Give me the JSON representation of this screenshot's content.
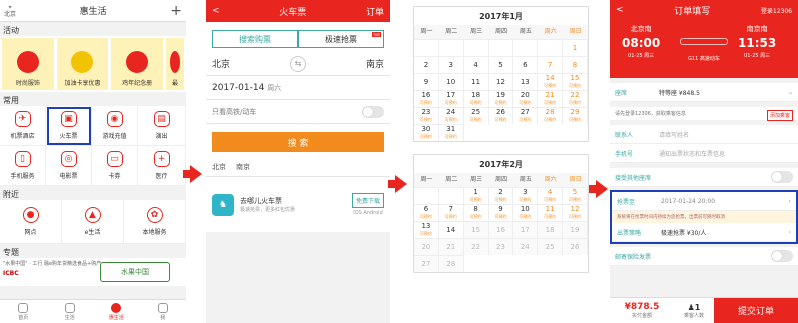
{
  "panel1": {
    "location": "北京",
    "title": "惠生活",
    "plus": "+",
    "activities_label": "活动",
    "activities": [
      "时尚服饰",
      "加油卡享优惠",
      "鸡年纪念册",
      "最"
    ],
    "activity_colors": [
      "#e8261f",
      "#f2c300",
      "#e8261f",
      "#e8261f"
    ],
    "common_label": "常用",
    "common_items": [
      "机票酒店",
      "火车票",
      "游戏充值",
      "演出",
      "手机服务",
      "电影票",
      "卡券",
      "医疗"
    ],
    "nearby_label": "附近",
    "nearby_items": [
      "网点",
      "e生活",
      "本地服务"
    ],
    "topic_label": "专题",
    "promo_text": "\"水果中国\" · 工行 融e购年货精选食品+购产",
    "promo_logo1": "ICBC",
    "promo_logo2": "水果中国",
    "tabs": [
      "首页",
      "生活",
      "惠生活",
      "我"
    ]
  },
  "panel2": {
    "title": "火车票",
    "back": "<",
    "right": "订单",
    "seg_on": "搜索购票",
    "seg_off": "极速抢票",
    "hot": "hot",
    "from": "北京",
    "to": "南京",
    "swap": "⇆",
    "date": "2017-01-14",
    "weekday": "周六",
    "high_speed_only": "只看高铁/动车",
    "search": "搜 索",
    "history_from": "北京",
    "history_to": "南京",
    "banner_title": "去哪儿火车票",
    "banner_sub": "极速抢票，更多红包优惠",
    "download": "免费下载",
    "os": "IOS Android"
  },
  "panel3": {
    "week": [
      "周一",
      "周二",
      "周三",
      "周四",
      "周五",
      "周六",
      "周日"
    ],
    "jan_title": "2017年1月",
    "feb_title": "2017年2月",
    "bookable": "可预约",
    "jan_days": [
      "",
      "",
      "",
      "",
      "",
      "",
      "1",
      "2",
      "3",
      "4",
      "5",
      "6",
      "7",
      "8",
      "9",
      "10",
      "11",
      "12",
      "13",
      "14",
      "15",
      "16",
      "17",
      "18",
      "19",
      "20",
      "21",
      "22",
      "23",
      "24",
      "25",
      "26",
      "27",
      "28",
      "29",
      "30",
      "31"
    ],
    "feb_days": [
      "",
      "",
      "1",
      "2",
      "3",
      "4",
      "5",
      "6",
      "7",
      "8",
      "9",
      "10",
      "11",
      "12",
      "13",
      "14",
      "15",
      "16",
      "17",
      "18",
      "19",
      "20",
      "21",
      "22",
      "23",
      "24",
      "25",
      "26",
      "27",
      "28"
    ]
  },
  "panel4": {
    "back": "<",
    "title": "订单填写",
    "login": "登录12306",
    "from_station": "北京南",
    "to_station": "南京南",
    "dep_time": "08:00",
    "arr_time": "11:53",
    "dep_date": "01-25 周三",
    "arr_date": "01-25 周三",
    "train": "G11 高速动车",
    "duration": "3小时53分",
    "seat_label": "座席",
    "seat_value": "特等座 ¥848.5",
    "notice": "请先登录12306，获取乘客信息",
    "add_passenger": "添加乘客",
    "contact_label": "联系人",
    "contact_ph": "请填写姓名",
    "phone_label": "手机号",
    "phone_ph": "通知出票状态和车票信息",
    "receive_label": "接受其他座席",
    "grab_time_label": "抢票至",
    "grab_time_value": "2017-01-24 20:00",
    "warn": "系统将在抢票时间内持续为您抢票，出票前可随时取消",
    "grab_type_label": "出票策略",
    "grab_type_value": "极速抢票 ¥30/人",
    "insurance_label": "邮寄保险发票",
    "price": "¥878.5",
    "price_sub": "实付金额",
    "pax": "1",
    "pax_sub": "乘客人数",
    "submit": "提交订单"
  }
}
